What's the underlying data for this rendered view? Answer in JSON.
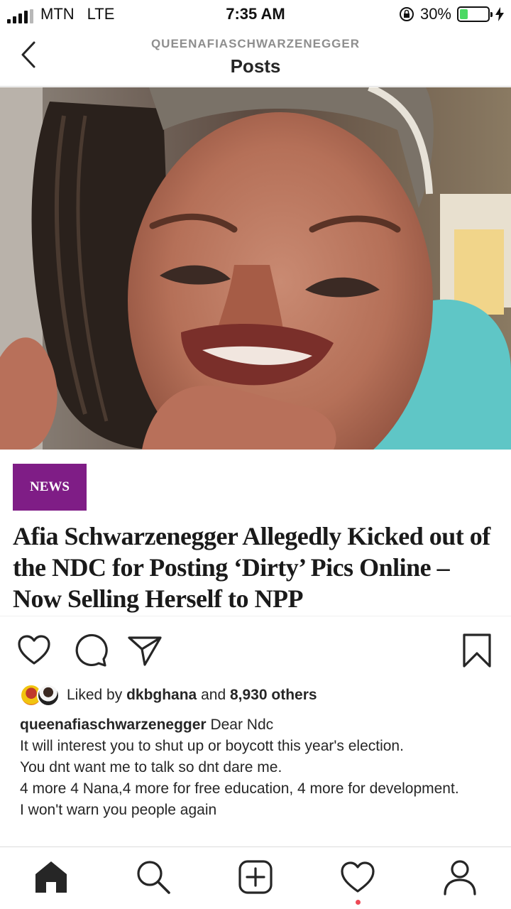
{
  "status_bar": {
    "carrier": "MTN",
    "network": "LTE",
    "time": "7:35 AM",
    "battery_percent": "30%",
    "battery_level": 0.3,
    "battery_color": "#4cd964"
  },
  "header": {
    "username": "QUEENAFIASCHWARZENEGGER",
    "title": "Posts",
    "back_icon": "chevron-left-icon"
  },
  "post": {
    "article": {
      "tag": "NEWS",
      "tag_color": "#7f1d86",
      "headline": "Afia Schwarzenegger Allegedly Kicked out of the NDC for Posting ‘Dirty’ Pics Online – Now Selling Herself to NPP"
    },
    "actions": [
      "heart-icon",
      "comment-icon",
      "share-icon",
      "bookmark-icon"
    ],
    "likes": {
      "prefix": "Liked by",
      "user": "dkbghana",
      "joiner": "and",
      "others": "8,930 others"
    },
    "caption": {
      "username": "queenafiaschwarzenegger",
      "first_line": "Dear Ndc",
      "lines": [
        "It will interest you to shut up or boycott this year's election.",
        "You dnt want me to talk so dnt dare me.",
        "4 more 4 Nana,4 more for free education, 4 more for development.",
        "I won't warn you people again"
      ]
    }
  },
  "tab_bar": {
    "items": [
      "home-icon",
      "search-icon",
      "new-post-icon",
      "activity-icon",
      "profile-icon"
    ],
    "notification_color": "#ed4956"
  }
}
